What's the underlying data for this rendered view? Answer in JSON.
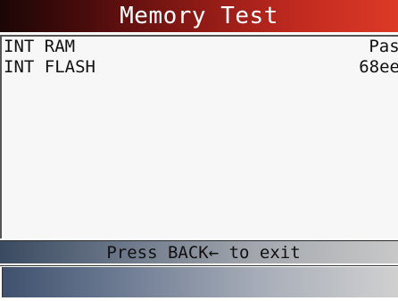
{
  "header": {
    "title": "Memory Test"
  },
  "results": [
    {
      "label": "INT RAM",
      "value": "Passed"
    },
    {
      "label": "INT FLASH",
      "value": "68ee"
    }
  ],
  "footer": {
    "hint_prefix": "Press BACK",
    "back_symbol": "←",
    "hint_suffix": " to exit"
  },
  "colors": {
    "title_bar_dark": "#1c0606",
    "title_bar_light": "#dc3a26",
    "status_bar_dark": "#3a4a60",
    "status_bar_light": "#c8c8c8"
  }
}
